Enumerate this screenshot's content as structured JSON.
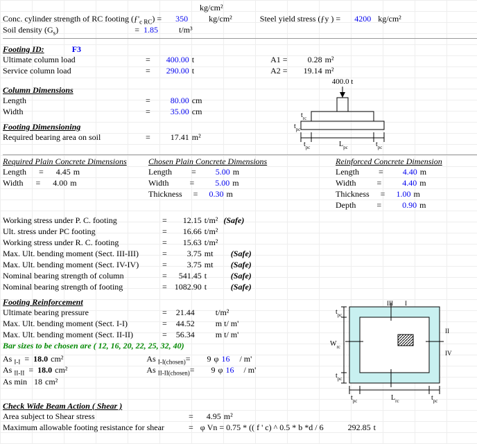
{
  "top": {
    "rc_label": "Conc. cylinder strength of RC footing (ƒ'",
    "rc_sub": "c RC",
    "rc_close": ") =",
    "rc_val": "350",
    "rc_unit": "kg/cm²",
    "steel_label": "Steel yield stress (ƒy ) =",
    "steel_val": "4200",
    "steel_unit": "kg/cm²",
    "soil_label": "Soil density (G",
    "soil_sub": "s",
    "soil_close": ")",
    "soil_eq": "=",
    "soil_val": "1.85",
    "soil_unit": "t/m³",
    "pc_partial": "kg/cm²"
  },
  "footing": {
    "id_label": "Footing ID:",
    "id": "F3",
    "ult_label": "Ultimate column load",
    "ult_val": "400.00",
    "ult_unit": "t",
    "svc_label": "Service column load",
    "svc_val": "290.00",
    "svc_unit": "t",
    "a1_label": "A1 =",
    "a1_val": "0.28",
    "a1_unit": "m²",
    "a2_label": "A2 =",
    "a2_val": "19.14",
    "a2_unit": "m²"
  },
  "coldim": {
    "title": "Column Dimensions",
    "len_label": "Length",
    "len_val": "80.00",
    "wid_label": "Width",
    "wid_val": "35.00",
    "unit": "cm"
  },
  "footdim": {
    "title": "Footing Dimensioning",
    "area_label": "Required bearing area on soil",
    "area_val": "17.41",
    "area_unit": "m²"
  },
  "dim_tables": {
    "req": {
      "title": "Required Plain Concrete Dimensions",
      "len": "4.45",
      "wid": "4.00"
    },
    "chosen": {
      "title": "Chosen Plain Concrete Dimensions",
      "len": "5.00",
      "wid": "5.00",
      "thk": "0.30"
    },
    "rc": {
      "title": "Reinforced Concrete Dimension",
      "len": "4.40",
      "wid": "4.40",
      "thk": "1.00",
      "dep": "0.90"
    },
    "labels": {
      "len": "Length",
      "wid": "Width",
      "thk": "Thickness",
      "dep": "Depth",
      "eq": "=",
      "m": "m"
    }
  },
  "stress": {
    "r1": {
      "l": "Working stress under P. C. footing",
      "v": "12.15",
      "u": "t/m²",
      "s": "(Safe)"
    },
    "r2": {
      "l": "Ult. stress under PC footing",
      "v": "16.66",
      "u": "t/m²"
    },
    "r3": {
      "l": "Working stress under R. C. footing",
      "v": "15.63",
      "u": "t/m²"
    },
    "r4": {
      "l": "Max. Ult. bending moment (Sect. III-III)",
      "v": "3.75",
      "u": "mt",
      "s": "(Safe)"
    },
    "r5": {
      "l": "Max. Ult. bending moment (Sect. IV-IV)",
      "v": "3.75",
      "u": "mt",
      "s": "(Safe)"
    },
    "r6": {
      "l": "Nominal bearing strength of column",
      "v": "541.45",
      "u": "t",
      "s": "(Safe)"
    },
    "r7": {
      "l": "Nominal bearing strength of footing",
      "v": "1082.90",
      "u": "t",
      "s": "(Safe)"
    }
  },
  "reinf": {
    "title": "Footing Reinforcement",
    "r1": {
      "l": "Ultimate bearing pressure",
      "v": "21.44",
      "u": "t/m²"
    },
    "r2": {
      "l": " Max. Ult. bending moment (Sect. I-I)",
      "v": "44.52",
      "u": "m t/ m'"
    },
    "r3": {
      "l": " Max. Ult. bending moment (Sect. II-II)",
      "v": "56.34",
      "u": "m t/ m'"
    },
    "bars": "Bar sizes to be chosen are ( 12, 16, 20, 22, 25, 32, 40)"
  },
  "as": {
    "r1a": {
      "l": "As",
      "sub": "I-I",
      "eq": "=",
      "v": "18.0",
      "u": "cm²"
    },
    "r1b": {
      "l": "As",
      "sub": "I-I(chosen)",
      "eq": "=",
      "n": "9",
      "phi": "φ",
      "d": "16",
      "per": "/ m'"
    },
    "r2a": {
      "l": "As",
      "sub": "II-II",
      "eq": "=",
      "v": "18.0",
      "u": "cm²"
    },
    "r2b": {
      "l": "As",
      "sub": "II-II(chosen)",
      "eq": "=",
      "n": "9",
      "phi": "φ",
      "d": "16",
      "per": "/ m'"
    },
    "r3": {
      "l": "As min",
      "v": "18",
      "u": "cm²"
    }
  },
  "shear": {
    "title": "Check Wide Beam Action ( Shear )",
    "area_l": "Area subject to Shear stress",
    "area_v": "4.95",
    "area_u": "m²",
    "max_l": "Maximum allowable footing resistance for shear",
    "formula": "φ Vn = 0.75 * (( f ' c) ^ 0.5 * b *d / 6",
    "max_v": "292.85",
    "max_u": "t"
  },
  "diagram1": {
    "load": "400.0 t",
    "trc": "t",
    "tpc": "t",
    "lpc": "L"
  },
  "diagram2": {
    "tpc": "t",
    "wrc": "W",
    "lrc": "L"
  }
}
